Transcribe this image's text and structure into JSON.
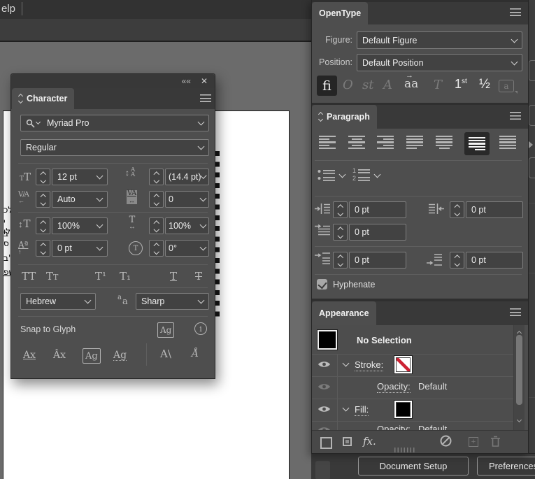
{
  "menubar": {
    "menu_fragment": "elp"
  },
  "artboard": {
    "fragments": [
      "לכ",
      "י לו",
      "ב ס",
      "ר\"ב",
      "שפ"
    ]
  },
  "character": {
    "tab": "Character",
    "font_family": "Myriad Pro",
    "font_style": "Regular",
    "font_size": "12 pt",
    "leading": "(14.4 pt)",
    "kerning": "Auto",
    "tracking": "0",
    "vertical_scale": "100%",
    "horizontal_scale": "100%",
    "baseline_shift": "0 pt",
    "rotation": "0°",
    "language": "Hebrew",
    "anti_aliasing": "Sharp",
    "snap_to_glyph": "Snap to Glyph",
    "case": {
      "all_caps": "TT",
      "small_caps_a": "T",
      "small_caps_b": "T",
      "superscript": "T¹",
      "subscript": "T₁",
      "underline": "T",
      "strikethrough": "T"
    }
  },
  "icons": {
    "size_small": "T",
    "size_big": "T",
    "leading_arrow": "↕",
    "leading_a": "A",
    "kerning_top": "V/A",
    "kerning_arrow": "←",
    "tracking_top": "VA",
    "tracking_arrow": "↔",
    "vscale_arrow": "↕",
    "vscale_t": "T",
    "hscale_t": "T",
    "hscale_arrow": "↔",
    "baseline_text": "Aª",
    "baseline_arrow": "↑",
    "rotation_t": "T",
    "aa_small": "a",
    "aa_big": "a",
    "snap_badge": "Ag",
    "info": "i",
    "snap_baseline": "Ax",
    "snap_xheight": "Âx",
    "snap_bounds": "Ag",
    "snap_near": "Ag",
    "snap_angular": "A\\",
    "snap_anchor": "Å",
    "list_num1": "1",
    "list_num2": "2",
    "fx": "fx."
  },
  "opentype": {
    "tab": "OpenType",
    "figure_label": "Figure:",
    "figure_value": "Default Figure",
    "position_label": "Position:",
    "position_value": "Default Position",
    "glyphs": {
      "ligatures": "fi",
      "contextual": "O",
      "discretionary": "st",
      "swash": "A",
      "stylistic": "aa",
      "titling": "T",
      "ordinal_num": "1",
      "ordinal_suffix": "st",
      "fractions": "½",
      "stylistic_set": "a"
    }
  },
  "paragraph": {
    "tab": "Paragraph",
    "left_indent": "0 pt",
    "right_indent": "0 pt",
    "first_line_indent": "0 pt",
    "space_before": "0 pt",
    "space_after": "0 pt",
    "hyphenate": "Hyphenate"
  },
  "appearance": {
    "tab": "Appearance",
    "no_selection": "No Selection",
    "stroke_label": "Stroke:",
    "fill_label": "Fill:",
    "stroke_opacity_label": "Opacity:",
    "stroke_opacity_value": "Default",
    "fill_opacity_label": "Opacity:",
    "fill_opacity_value": "Default"
  },
  "quick_actions": {
    "document_setup": "Document Setup",
    "preferences": "Preferences"
  },
  "colors": {
    "none_red": "#cc2233",
    "fill_black": "#000000",
    "selection_box": "#292929"
  }
}
